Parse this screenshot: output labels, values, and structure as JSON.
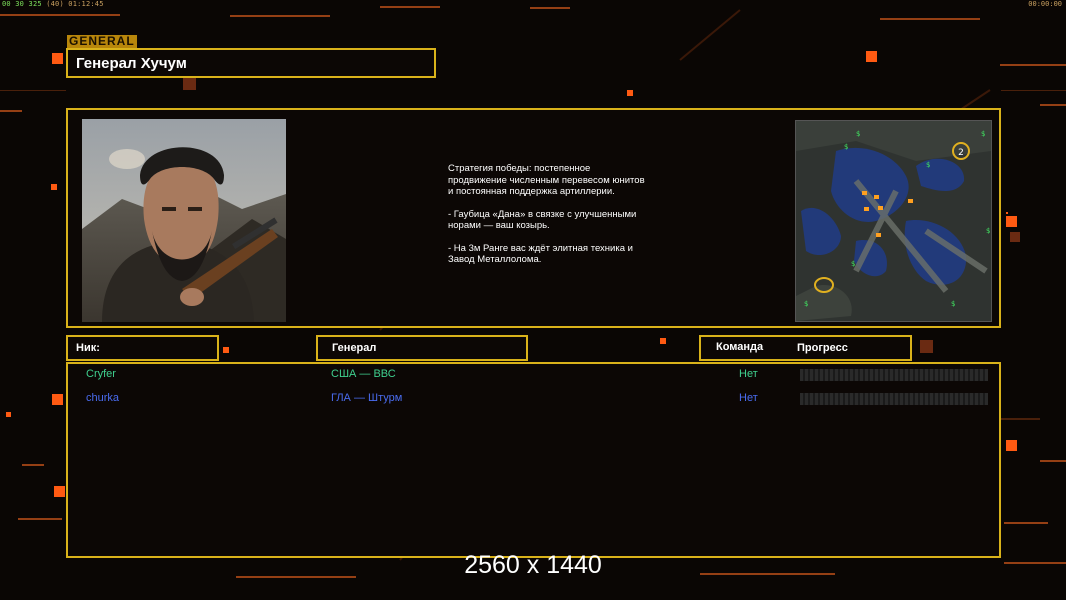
{
  "hud": {
    "stats": [
      "00",
      "30",
      "325",
      "(40)",
      "01:12:45"
    ],
    "clock": "00:00:00"
  },
  "screen": {
    "tag": "GENERAL",
    "general_name": "Генерал Хучум"
  },
  "briefing": {
    "lines": [
      "Стратегия победы: постепенное продвижение численным перевесом юнитов и постоянная поддержка артиллерии.",
      "- Гаубица «Дана» в связке с улучшенными норами — ваш козырь.",
      "- На 3м Ранге вас ждёт элитная техника и Завод Металлолома."
    ]
  },
  "minimap": {
    "player_marker": "2"
  },
  "table": {
    "headers": {
      "nick": "Ник:",
      "general": "Генерал",
      "team": "Команда",
      "progress": "Прогресс"
    },
    "rows": [
      {
        "nick": "Cryfer",
        "general": "США — ВВС",
        "team": "Нет",
        "color": "#3fcf8e"
      },
      {
        "nick": "churka",
        "general": "ГЛА — Штурм",
        "team": "Нет",
        "color": "#4a6cf0"
      }
    ]
  },
  "resolution_note": "2560 x 1440",
  "colors": {
    "accent": "#d9b21a",
    "background": "#0a0604",
    "line": "#c4531a"
  }
}
